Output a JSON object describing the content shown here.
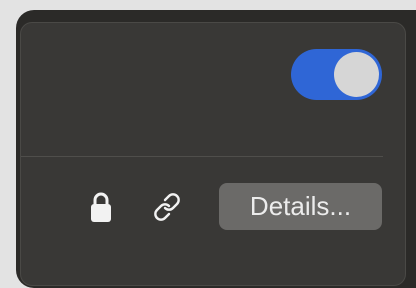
{
  "toggle": {
    "state": "on",
    "accent_color": "#2f66d6"
  },
  "icons": {
    "lock": "lock-icon",
    "link": "link-icon"
  },
  "details_button": {
    "label": "Details..."
  }
}
